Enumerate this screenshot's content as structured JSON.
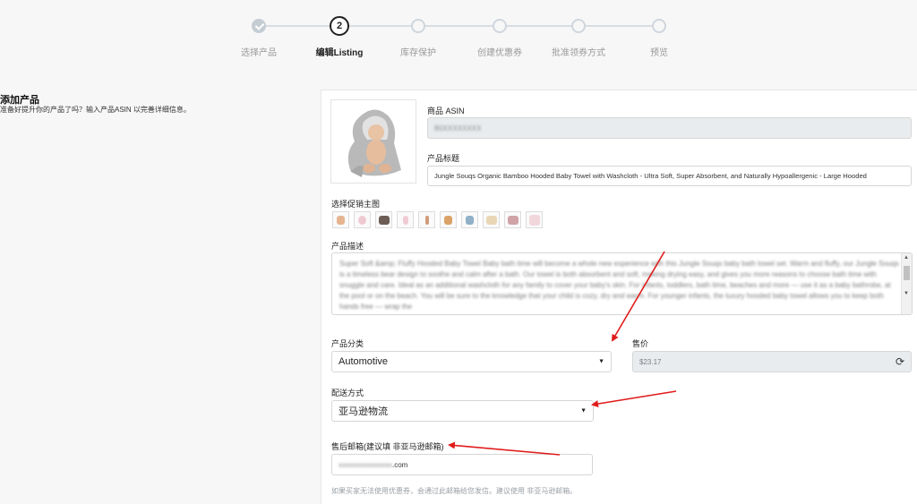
{
  "stepper": {
    "steps": [
      {
        "label": "选择产品",
        "state": "done"
      },
      {
        "label": "编辑Listing",
        "state": "active",
        "number": "2"
      },
      {
        "label": "库存保护",
        "state": "pending"
      },
      {
        "label": "创建优惠券",
        "state": "pending"
      },
      {
        "label": "批准领券方式",
        "state": "pending"
      },
      {
        "label": "预览",
        "state": "pending"
      }
    ]
  },
  "intro": {
    "title": "添加产品",
    "subtitle": "准备好提升你的产品了吗？输入产品ASIN 以完善详细信息。"
  },
  "form": {
    "asin_label": "商品 ASIN",
    "asin_value": "B0XXXXXXXX",
    "title_label": "产品标题",
    "title_value": "Jungle Souqs Organic Bamboo Hooded Baby Towel with Washcloth - Ultra Soft, Super Absorbent, and Naturally Hypoallergenic - Large Hooded",
    "gallery_label": "选择促销主图",
    "description_label": "产品描述",
    "description_value": "Super Soft &amp; Fluffy Hooded Baby Towel Baby bath time will become a whole new experience with this Jungle Souqs baby bath towel set. Warm and fluffy, our Jungle Souqs is a timeless bear design to soothe and calm after a bath. Our towel is both absorbent and soft, making drying easy, and gives you more reasons to choose bath time with snuggle and care. Ideal as an additional washcloth for any family to cover your baby's skin. For infants, toddlers, bath time, beaches and more — use it as a baby bathrobe, at the pool or on the beach. You will be sure to the knowledge that your child is cozy, dry and warm. For younger infants, the luxury hooded baby towel allows you to keep both hands free — wrap the",
    "category_label": "产品分类",
    "category_value": "Automotive",
    "price_label": "售价",
    "price_value": "$23.17",
    "shipping_label": "配送方式",
    "shipping_value": "亚马逊物流",
    "email_label": "售后邮箱(建议填 非亚马逊邮箱)",
    "email_masked": "xxxxxxxxxxxxxxx",
    "email_suffix": ".com",
    "email_hint": "如果买家无法使用优惠券，会通过此邮箱给您发信。建议使用 非亚马逊邮箱。"
  },
  "colors": {
    "accent_arrow": "#e01b1b",
    "panel_bg": "#ffffff",
    "page_bg": "#f7f7f7"
  },
  "icons": {
    "step_done": "check-icon",
    "dropdown": "chevron-down-icon",
    "price_refresh": "refresh-icon"
  }
}
